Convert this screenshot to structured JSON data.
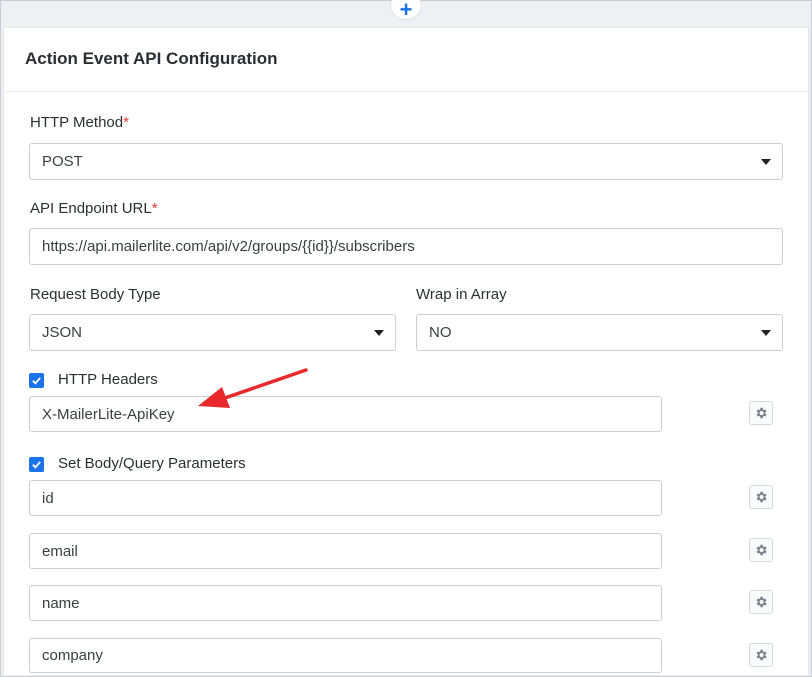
{
  "card": {
    "title": "Action Event API Configuration"
  },
  "http_method": {
    "label": "HTTP Method",
    "required_mark": "*",
    "value": "POST"
  },
  "endpoint": {
    "label": "API Endpoint URL",
    "required_mark": "*",
    "value": "https://api.mailerlite.com/api/v2/groups/{{id}}/subscribers"
  },
  "body_type": {
    "label": "Request Body Type",
    "value": "JSON"
  },
  "wrap_array": {
    "label": "Wrap in Array",
    "value": "NO"
  },
  "headers": {
    "label": "HTTP Headers",
    "checked": true,
    "items": [
      "X-MailerLite-ApiKey"
    ]
  },
  "params": {
    "label": "Set Body/Query Parameters",
    "checked": true,
    "items": [
      "id",
      "email",
      "name",
      "company"
    ]
  },
  "colors": {
    "accent": "#1a73e8",
    "required": "#e53935",
    "annotation_arrow": "#e8282b"
  },
  "icons": {
    "add": "plus-icon",
    "settings": "gear-icon",
    "checkbox": "checkmark-icon",
    "dropdown": "caret-down-icon"
  }
}
